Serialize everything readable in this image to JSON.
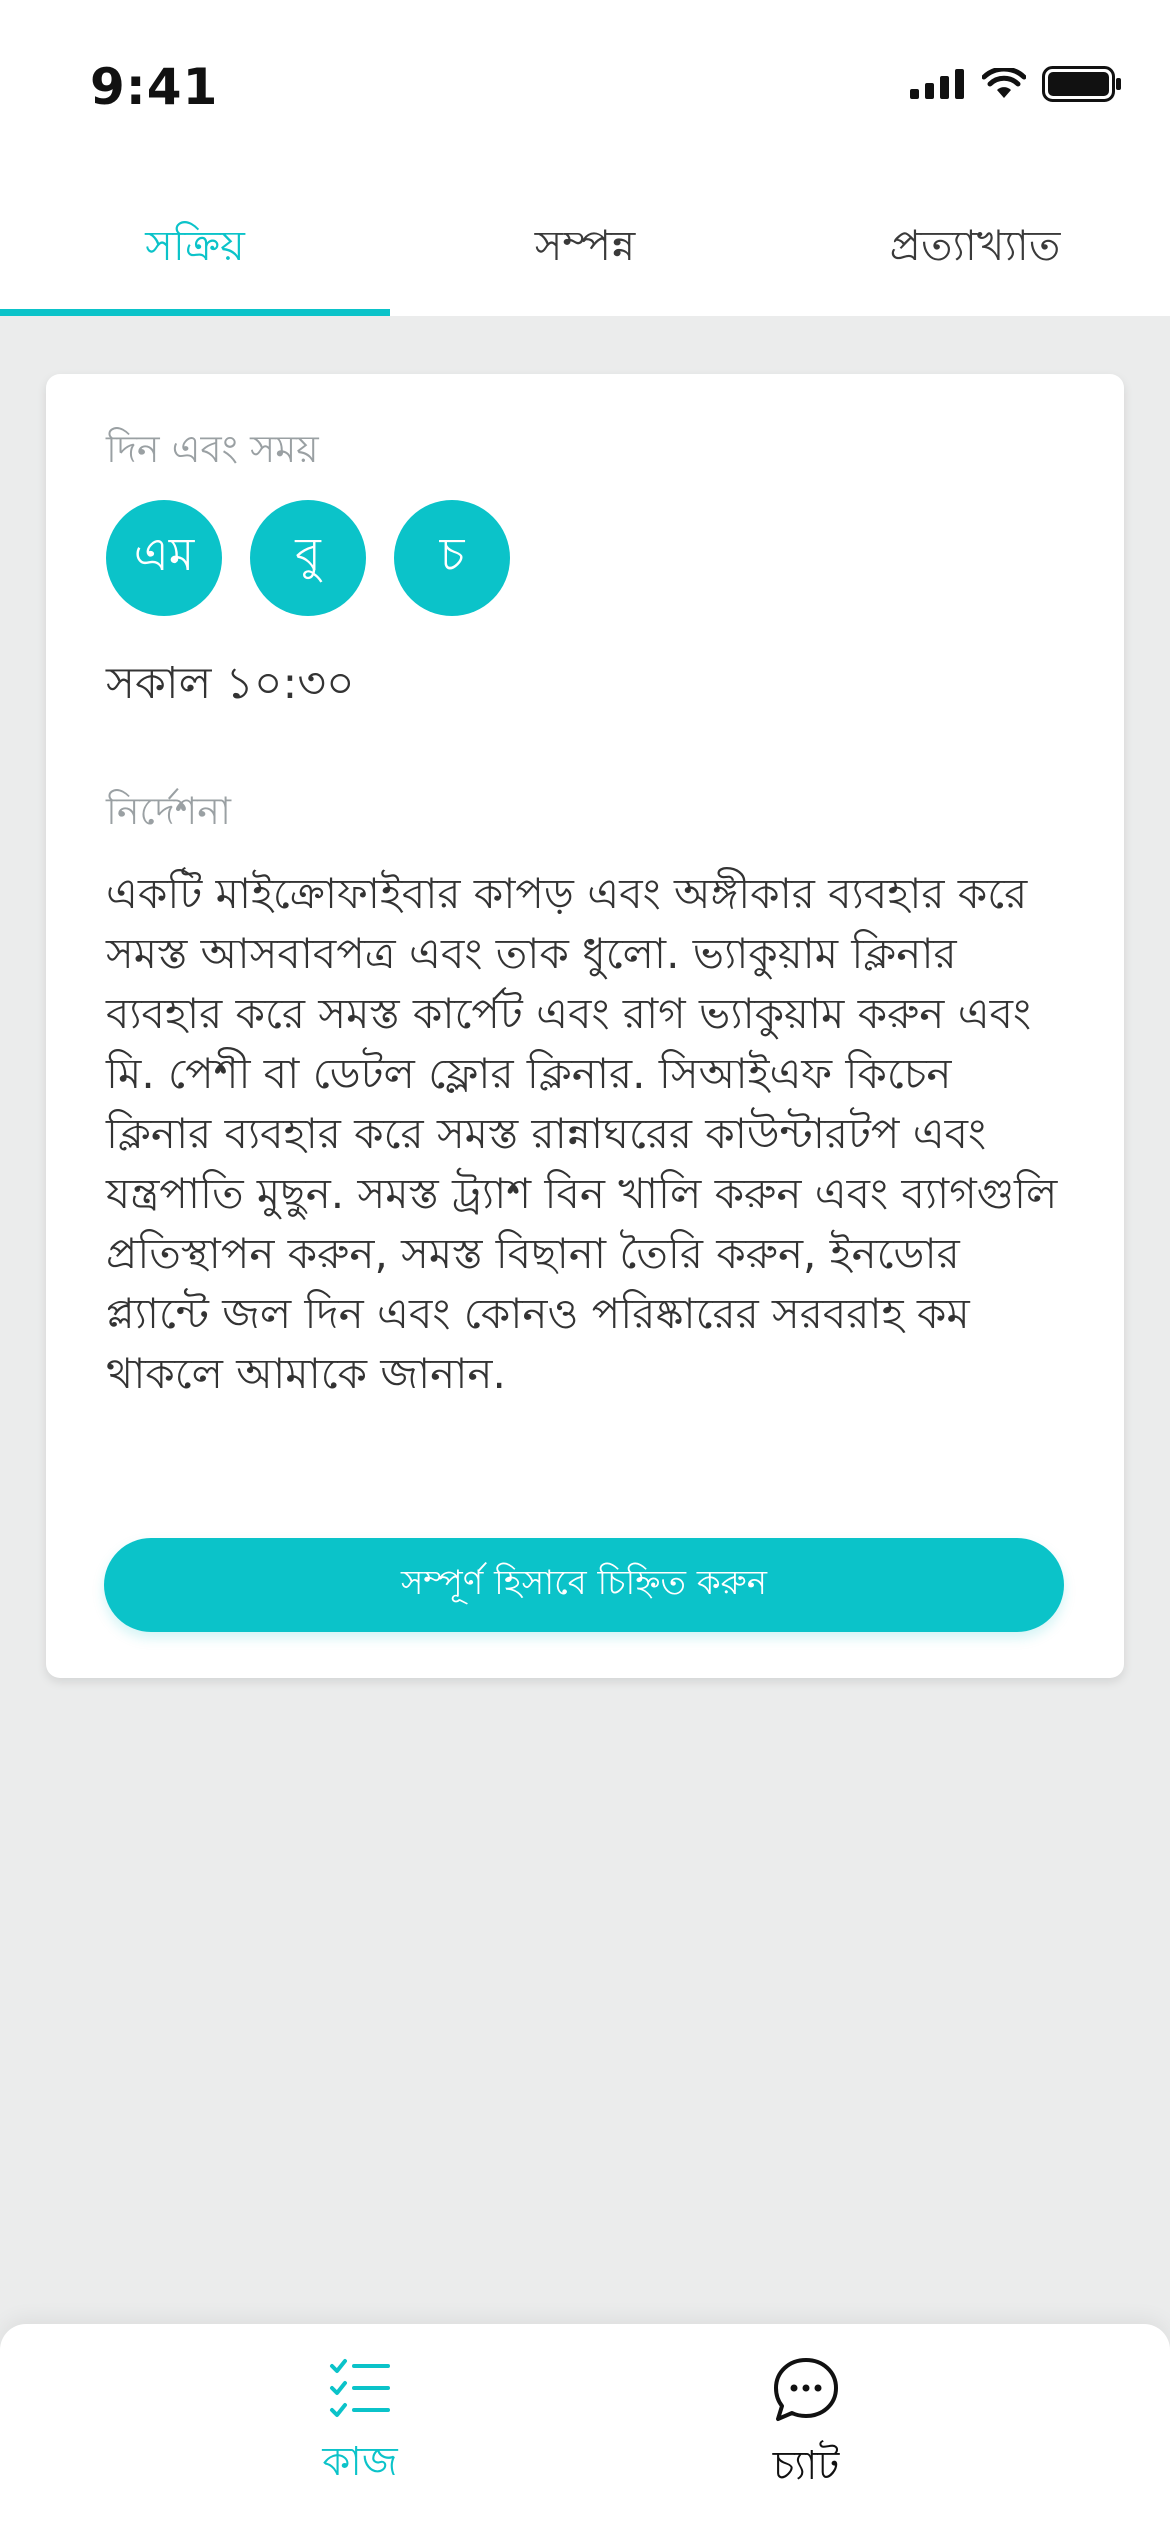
{
  "status_bar": {
    "time": "9:41",
    "icons": [
      "signal-icon",
      "wifi-icon",
      "battery-icon"
    ]
  },
  "tabs": [
    {
      "label": "সক্রিয়",
      "active": true
    },
    {
      "label": "সম্পন্ন",
      "active": false
    },
    {
      "label": "প্রত্যাখ্যাত",
      "active": false
    }
  ],
  "card": {
    "day_time_label": "দিন এবং সময়",
    "days": [
      "এম",
      "বু",
      "চ"
    ],
    "time": "সকাল ১০:৩০",
    "instructions_label": "নির্দেশনা",
    "instructions_text": "একটি মাইক্রোফাইবার কাপড় এবং অঙ্গীকার ব্যবহার করে সমস্ত আসবাবপত্র এবং তাক ধুলো. ভ্যাকুয়াম ক্লিনার ব্যবহার করে সমস্ত কার্পেট এবং রাগ ভ্যাকুয়াম করুন এবং মি. পেশী বা ডেটল ফ্লোর ক্লিনার. সিআইএফ কিচেন ক্লিনার ব্যবহার করে সমস্ত রান্নাঘরের কাউন্টারটপ এবং যন্ত্রপাতি মুছুন. সমস্ত ট্র্যাশ বিন খালি করুন এবং ব্যাগগুলি প্রতিস্থাপন করুন, সমস্ত বিছানা তৈরি করুন, ইনডোর প্ল্যান্টে জল দিন এবং কোনও পরিষ্কারের সরবরাহ কম থাকলে আমাকে জানান.",
    "complete_button_label": "সম্পূর্ণ হিসাবে চিহ্নিত করুন"
  },
  "bottom_nav": {
    "items": [
      {
        "label": "কাজ",
        "icon": "checklist-icon",
        "active": true
      },
      {
        "label": "চ্যাট",
        "icon": "chat-bubble-icon",
        "active": false
      }
    ]
  },
  "colors": {
    "accent": "#0bc3c9",
    "background": "#ebecec",
    "text": "#333333",
    "muted": "#9aa0a3"
  }
}
